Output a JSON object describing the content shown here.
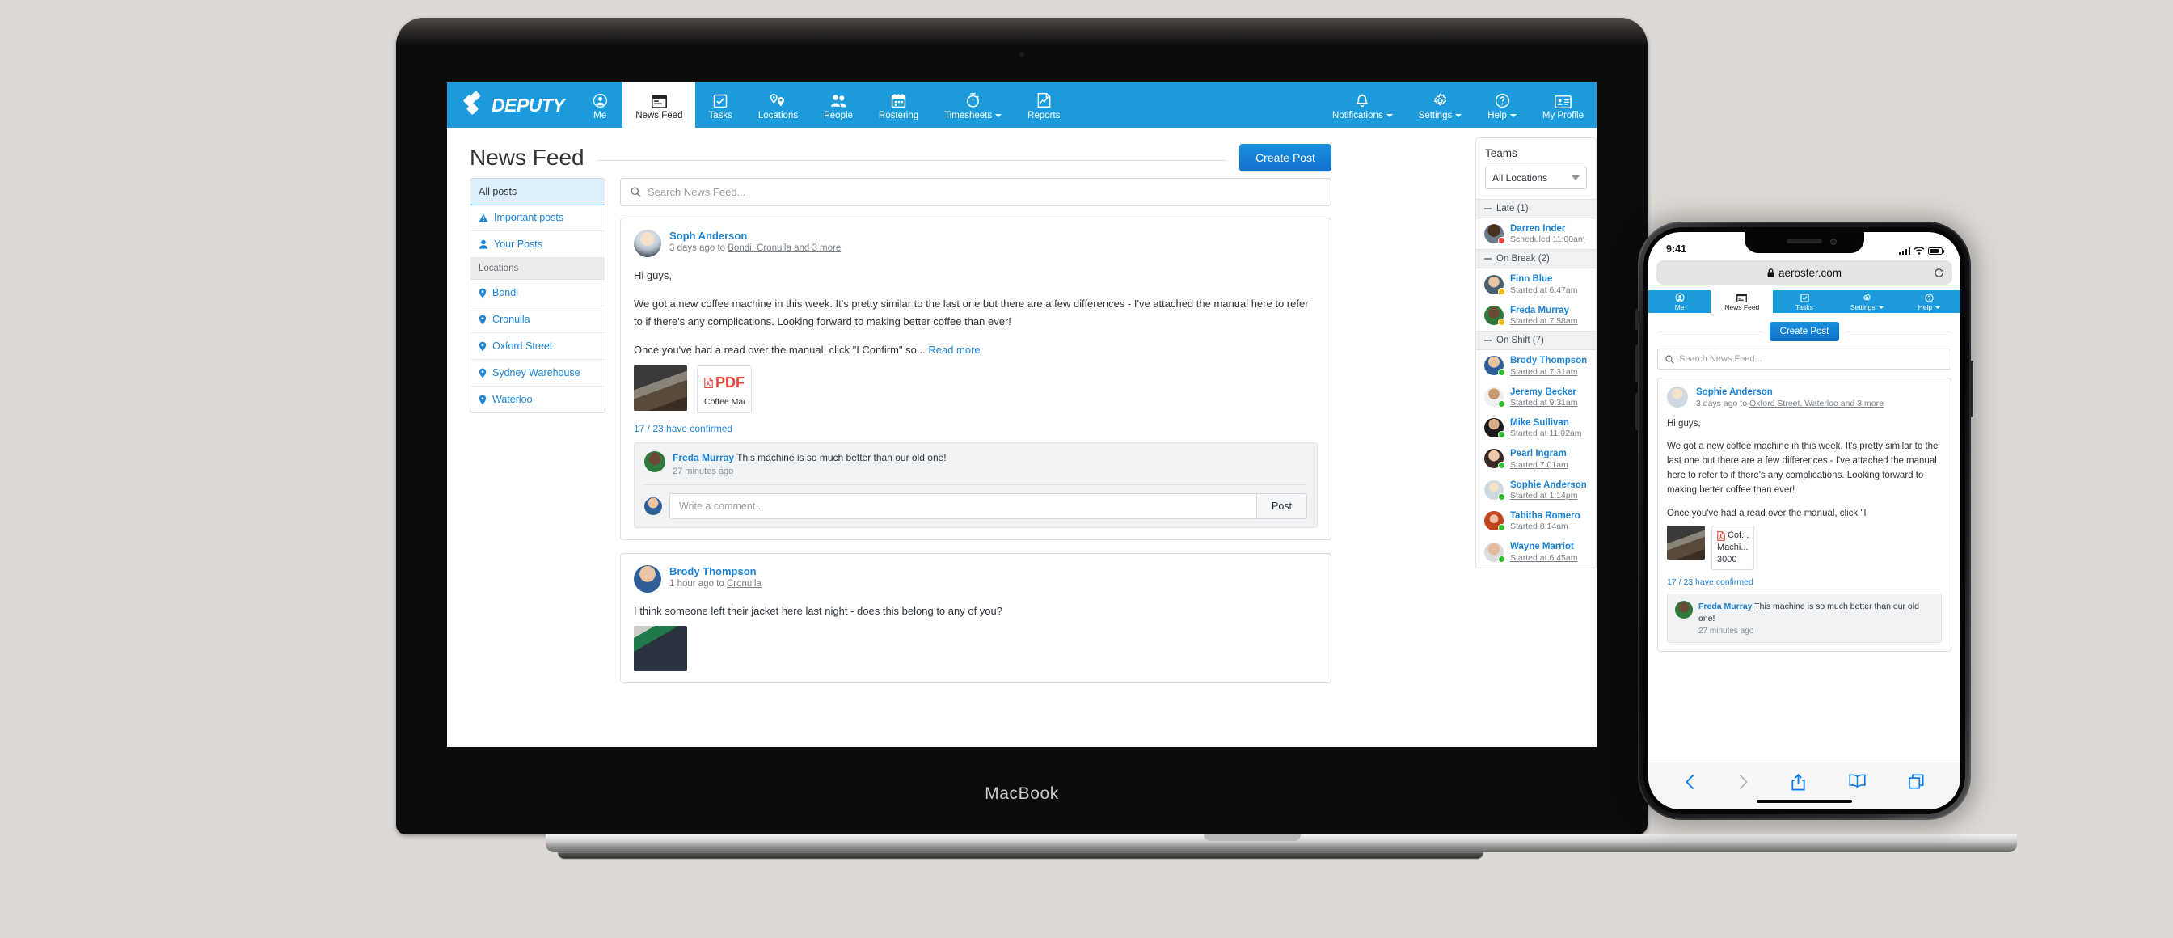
{
  "desktop": {
    "brand": "DEPUTY",
    "nav_left": [
      {
        "label": "Me",
        "icon": "user-circle-icon",
        "active": false
      },
      {
        "label": "News Feed",
        "icon": "news-feed-icon",
        "active": true
      },
      {
        "label": "Tasks",
        "icon": "checkbox-icon",
        "active": false
      },
      {
        "label": "Locations",
        "icon": "map-pin-icon",
        "active": false
      },
      {
        "label": "People",
        "icon": "people-icon",
        "active": false
      },
      {
        "label": "Rostering",
        "icon": "calendar-icon",
        "active": false
      },
      {
        "label": "Timesheets",
        "icon": "stopwatch-icon",
        "active": false,
        "caret": true
      },
      {
        "label": "Reports",
        "icon": "chart-document-icon",
        "active": false
      }
    ],
    "nav_right": [
      {
        "label": "Notifications",
        "icon": "bell-icon",
        "caret": true
      },
      {
        "label": "Settings",
        "icon": "gear-icon",
        "caret": true
      },
      {
        "label": "Help",
        "icon": "question-circle-icon",
        "caret": true
      },
      {
        "label": "My Profile",
        "icon": "id-card-icon",
        "caret": false
      }
    ],
    "page_title": "News Feed",
    "create_post": "Create Post",
    "filters": [
      {
        "label": "All posts",
        "icon": "",
        "selected": true
      },
      {
        "label": "Important posts",
        "icon": "warning-triangle-icon",
        "selected": false
      },
      {
        "label": "Your Posts",
        "icon": "person-icon",
        "selected": false
      }
    ],
    "filters_group_label": "Locations",
    "locations": [
      {
        "label": "Bondi",
        "icon": "map-pin-icon"
      },
      {
        "label": "Cronulla",
        "icon": "map-pin-icon"
      },
      {
        "label": "Oxford Street",
        "icon": "map-pin-icon"
      },
      {
        "label": "Sydney Warehouse",
        "icon": "map-pin-icon"
      },
      {
        "label": "Waterloo",
        "icon": "map-pin-icon"
      }
    ],
    "search_placeholder": "Search News Feed...",
    "post1": {
      "author": "Soph Anderson",
      "meta_prefix": "3 days ago to ",
      "meta_link": "Bondi, Cronulla and 3 more",
      "line1": "Hi guys,",
      "line2": "We got a new coffee machine in this week. It's pretty similar to the last one but there are a few differences - I've attached the manual here to refer to if there's any complications. Looking forward to making better coffee than ever!",
      "line3": "Once you've had a read over the manual, click \"I Confirm\" so...",
      "read_more": "Read more",
      "pdf_label": "PDF",
      "pdf_name": "Coffee Mac...",
      "confirmed": "17 / 23 have confirmed",
      "comment_author": "Freda Murray",
      "comment_text": " This machine is so much better than our old one!",
      "comment_time": "27 minutes ago",
      "comment_placeholder": "Write a comment...",
      "post_button": "Post"
    },
    "post2": {
      "author": "Brody Thompson",
      "meta_prefix": "1 hour ago to ",
      "meta_link": "Cronulla",
      "body": "I think someone left their jacket here last night - does this belong to any of you?"
    },
    "teams": {
      "title": "Teams",
      "location_filter": "All Locations",
      "groups": [
        {
          "label": "Late (1)",
          "status_color": "#f0413f",
          "people": [
            {
              "name": "Darren Inder",
              "sub": "Scheduled 11:00am"
            }
          ]
        },
        {
          "label": "On Break (2)",
          "status_color": "#f5b80a",
          "people": [
            {
              "name": "Finn Blue",
              "sub": "Started at 6:47am"
            },
            {
              "name": "Freda Murray",
              "sub": "Started at 7:58am"
            }
          ]
        },
        {
          "label": "On Shift (7)",
          "status_color": "#2fbe2f",
          "people": [
            {
              "name": "Brody Thompson",
              "sub": "Started at 7:31am"
            },
            {
              "name": "Jeremy Becker",
              "sub": "Started at 9:31am"
            },
            {
              "name": "Mike Sullivan",
              "sub": "Started at 11:02am"
            },
            {
              "name": "Pearl Ingram",
              "sub": "Started 7:01am"
            },
            {
              "name": "Sophie Anderson",
              "sub": "Started at 1:14pm"
            },
            {
              "name": "Tabitha Romero",
              "sub": "Started 8:14am"
            },
            {
              "name": "Wayne Marriot",
              "sub": "Started at 6:45am"
            }
          ]
        }
      ]
    },
    "device_label": "MacBook"
  },
  "mobile": {
    "status_time": "9:41",
    "url": "aeroster.com",
    "nav": [
      {
        "label": "Me",
        "icon": "user-circle-icon",
        "active": false,
        "caret": false
      },
      {
        "label": "News Feed",
        "icon": "news-feed-icon",
        "active": true,
        "caret": false
      },
      {
        "label": "Tasks",
        "icon": "checkbox-icon",
        "active": false,
        "caret": false
      },
      {
        "label": "Settings",
        "icon": "gear-icon",
        "active": false,
        "caret": true
      },
      {
        "label": "Help",
        "icon": "question-circle-icon",
        "active": false,
        "caret": true
      }
    ],
    "create_post": "Create Post",
    "search_placeholder": "Search News Feed...",
    "post": {
      "author": "Sophie Anderson",
      "meta_prefix": "3 days ago to ",
      "meta_link": "Oxford Street, Waterloo and 3 more",
      "line1": "Hi guys,",
      "line2": "We got a new coffee machine in this week. It's pretty similar to the last one but there are a few differences - I've attached the manual here to refer to if there's any complications. Looking forward to making better coffee than ever!",
      "line3": "Once you've had a read over the manual, click \"I",
      "pdf_line1": "Cof...",
      "pdf_line2": "Machi...",
      "pdf_line3": "3000",
      "confirmed": "17 / 23 have confirmed",
      "comment_author": "Freda Murray",
      "comment_text": " This machine is so much better than our old one!",
      "comment_time": "27 minutes ago"
    },
    "toolbar": [
      {
        "icon": "back-chevron-icon",
        "dim": false
      },
      {
        "icon": "forward-chevron-icon",
        "dim": true
      },
      {
        "icon": "share-icon",
        "dim": false
      },
      {
        "icon": "bookmarks-book-icon",
        "dim": false
      },
      {
        "icon": "tabs-icon",
        "dim": false
      }
    ]
  },
  "colors": {
    "brand_blue": "#1b9bdc",
    "link_blue": "#1b84d8",
    "button_blue": "#0f71c9",
    "status_late": "#f0413f",
    "status_break": "#f5b80a",
    "status_onshift": "#2fbe2f",
    "pdf_red": "#ef4136",
    "page_bg": "#ded9d4"
  }
}
